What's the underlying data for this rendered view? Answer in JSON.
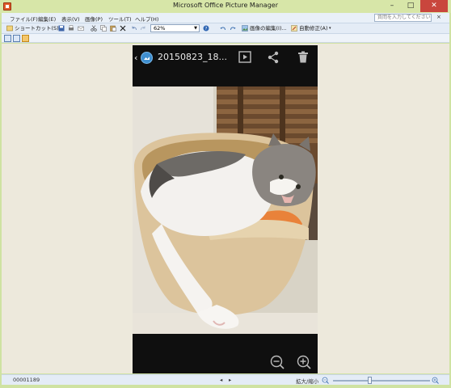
{
  "window": {
    "title": "Microsoft Office Picture Manager",
    "minimize": "–",
    "maximize": "□",
    "close": "✕"
  },
  "menu": {
    "items": [
      "ファイル(F)",
      "編集(E)",
      "表示(V)",
      "画像(P)",
      "ツール(T)",
      "ヘルプ(H)"
    ],
    "help_placeholder": "質問を入力してください",
    "close": "×"
  },
  "toolbar": {
    "shortcut": "ショートカット(S)...",
    "zoom_value": "62%",
    "edit_picture": "画像の編集(I)...",
    "auto_correct": "自動修正(A)"
  },
  "viewer": {
    "back": "‹",
    "photo_title": "20150823_18..."
  },
  "status": {
    "file_name": "00001189",
    "zoom_label": "拡大/縮小",
    "zoom_position": 0.38
  },
  "colors": {
    "frame": "#cfe2a2",
    "canvas": "#ede9dc",
    "phone": "#0f0f0f",
    "accent": "#3f8fd0",
    "close": "#c9463d"
  }
}
